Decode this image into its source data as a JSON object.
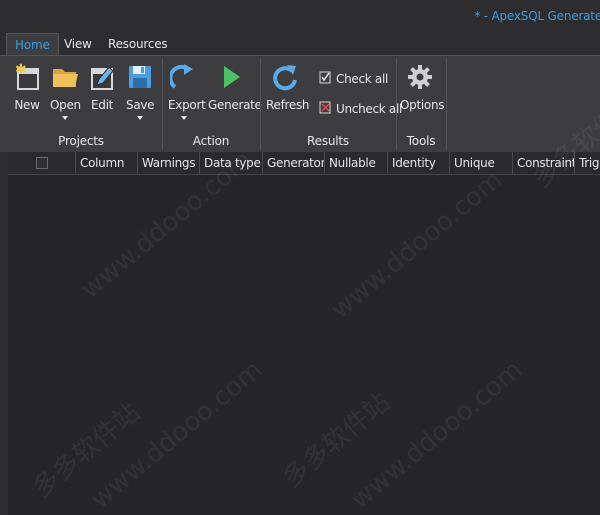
{
  "window": {
    "title": "* - ApexSQL Generate"
  },
  "tabs": [
    {
      "label": "Home",
      "active": true
    },
    {
      "label": "View",
      "active": false
    },
    {
      "label": "Resources",
      "active": false
    }
  ],
  "ribbon": {
    "projects": {
      "group_label": "Projects",
      "new_label": "New",
      "open_label": "Open",
      "edit_label": "Edit",
      "save_label": "Save"
    },
    "action": {
      "group_label": "Action",
      "export_label": "Export",
      "generate_label": "Generate"
    },
    "results": {
      "group_label": "Results",
      "refresh_label": "Refresh",
      "check_all_label": "Check all",
      "uncheck_all_label": "Uncheck all"
    },
    "tools": {
      "group_label": "Tools",
      "options_label": "Options"
    }
  },
  "grid": {
    "columns": [
      "Column",
      "Warnings",
      "Data type",
      "Generator",
      "Nullable",
      "Identity",
      "Unique",
      "Constraints",
      "Trigg"
    ]
  },
  "watermark": {
    "cn": "多多软件站",
    "url": "www.ddooo.com"
  },
  "colors": {
    "accent": "#3d9be0",
    "background": "#2d2d30",
    "ribbon": "#3d3d40",
    "grid": "#262628"
  }
}
